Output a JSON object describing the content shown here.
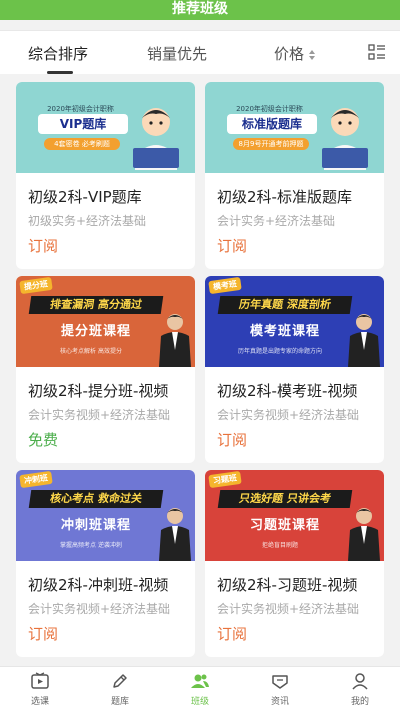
{
  "header": {
    "title": "推荐班级"
  },
  "sort": {
    "tabs": [
      "综合排序",
      "销量优先",
      "价格"
    ]
  },
  "colors": {
    "accent": "#6cc24a",
    "paid": "#e8733d",
    "free": "#4cae4c"
  },
  "cards": [
    {
      "banner": {
        "top_line": "2020年初级会计职称",
        "big": "VIP题库",
        "pill": "4套密卷 必考刷题"
      },
      "title": "初级2科-VIP题库",
      "subtitle": "初级实务+经济法基础",
      "action": "订阅"
    },
    {
      "banner": {
        "top_line": "2020年初级会计职称",
        "big": "标准版题库",
        "pill": "8月9号开通考前押题"
      },
      "title": "初级2科-标准版题库",
      "subtitle": "会计实务+经济法基础",
      "action": "订阅"
    },
    {
      "banner": {
        "tag": "提分班",
        "headline": "排查漏洞 高分通过",
        "course": "提分班课程",
        "note": "核心考点解析  高效提分"
      },
      "title": "初级2科-提分班-视频",
      "subtitle": "会计实务视频+经济法基础",
      "action": "免费"
    },
    {
      "banner": {
        "tag": "模考班",
        "headline": "历年真题 深度剖析",
        "course": "模考班课程",
        "note": "历年真题是出题专家的命题方向"
      },
      "title": "初级2科-模考班-视频",
      "subtitle": "会计实务视频+经济法基础",
      "action": "订阅"
    },
    {
      "banner": {
        "tag": "冲刺班",
        "headline": "核心考点 救命过关",
        "course": "冲刺班课程",
        "note": "掌握高频考点  逆袭冲刺"
      },
      "title": "初级2科-冲刺班-视频",
      "subtitle": "会计实务视频+经济法基础",
      "action": "订阅"
    },
    {
      "banner": {
        "tag": "习题班",
        "headline": "只选好题 只讲会考",
        "course": "习题班课程",
        "note": "拒绝盲目刷题"
      },
      "title": "初级2科-习题班-视频",
      "subtitle": "会计实务视频+经济法基础",
      "action": "订阅"
    }
  ],
  "tabbar": {
    "items": [
      {
        "label": "选课",
        "icon": "play-icon"
      },
      {
        "label": "题库",
        "icon": "pencil-icon"
      },
      {
        "label": "班级",
        "icon": "people-icon"
      },
      {
        "label": "资讯",
        "icon": "chat-icon"
      },
      {
        "label": "我的",
        "icon": "person-icon"
      }
    ]
  }
}
